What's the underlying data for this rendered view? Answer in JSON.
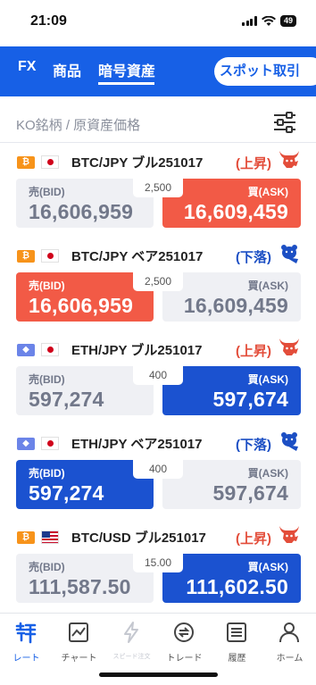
{
  "status": {
    "time": "21:09",
    "battery": "49"
  },
  "nav": {
    "tabs": [
      "FX",
      "商品",
      "暗号資産"
    ],
    "active_tab": "暗号資産",
    "spot_button": "スポット取引"
  },
  "section": {
    "title": "KO銘柄 / 原資産価格"
  },
  "cards": [
    {
      "coin": "BTC",
      "coin_badge": "₿",
      "coin_color": "#f7931a",
      "flag": "jp",
      "name": "BTC/JPY ブル251017",
      "direction": "(上昇)",
      "direction_type": "up",
      "bid_label": "売(BID)",
      "bid": "16,606,959",
      "spread": "2,500",
      "ask_label": "買(ASK)",
      "ask": "16,609,459",
      "highlight": "ask",
      "highlight_color": "red"
    },
    {
      "coin": "BTC",
      "coin_badge": "₿",
      "coin_color": "#f7931a",
      "flag": "jp",
      "name": "BTC/JPY ベア251017",
      "direction": "(下落)",
      "direction_type": "down",
      "bid_label": "売(BID)",
      "bid": "16,606,959",
      "spread": "2,500",
      "ask_label": "買(ASK)",
      "ask": "16,609,459",
      "highlight": "bid",
      "highlight_color": "red"
    },
    {
      "coin": "ETH",
      "coin_badge": "◆",
      "coin_color": "#6b84e8",
      "flag": "jp",
      "name": "ETH/JPY ブル251017",
      "direction": "(上昇)",
      "direction_type": "up",
      "bid_label": "売(BID)",
      "bid": "597,274",
      "spread": "400",
      "ask_label": "買(ASK)",
      "ask": "597,674",
      "highlight": "ask",
      "highlight_color": "blue"
    },
    {
      "coin": "ETH",
      "coin_badge": "◆",
      "coin_color": "#6b84e8",
      "flag": "jp",
      "name": "ETH/JPY ベア251017",
      "direction": "(下落)",
      "direction_type": "down",
      "bid_label": "売(BID)",
      "bid": "597,274",
      "spread": "400",
      "ask_label": "買(ASK)",
      "ask": "597,674",
      "highlight": "bid",
      "highlight_color": "blue"
    },
    {
      "coin": "BTC",
      "coin_badge": "₿",
      "coin_color": "#f7931a",
      "flag": "us",
      "name": "BTC/USD ブル251017",
      "direction": "(上昇)",
      "direction_type": "up",
      "bid_label": "売(BID)",
      "bid": "111,587.50",
      "spread": "15.00",
      "ask_label": "買(ASK)",
      "ask": "111,602.50",
      "highlight": "ask",
      "highlight_color": "blue"
    }
  ],
  "bottom_nav": [
    {
      "label": "レート",
      "icon": "rate-icon",
      "state": "active"
    },
    {
      "label": "チャート",
      "icon": "chart-icon",
      "state": "normal"
    },
    {
      "label": "スピード注文",
      "icon": "speed-order-icon",
      "state": "disabled"
    },
    {
      "label": "トレード",
      "icon": "trade-icon",
      "state": "normal"
    },
    {
      "label": "履歴",
      "icon": "history-icon",
      "state": "normal"
    },
    {
      "label": "ホーム",
      "icon": "home-icon",
      "state": "normal"
    }
  ],
  "colors": {
    "brand_blue": "#1760e6",
    "up_red": "#e34d3a",
    "down_blue": "#1c4fc4",
    "ask_red": "#f25a46",
    "bid_blue": "#1b52d0"
  }
}
